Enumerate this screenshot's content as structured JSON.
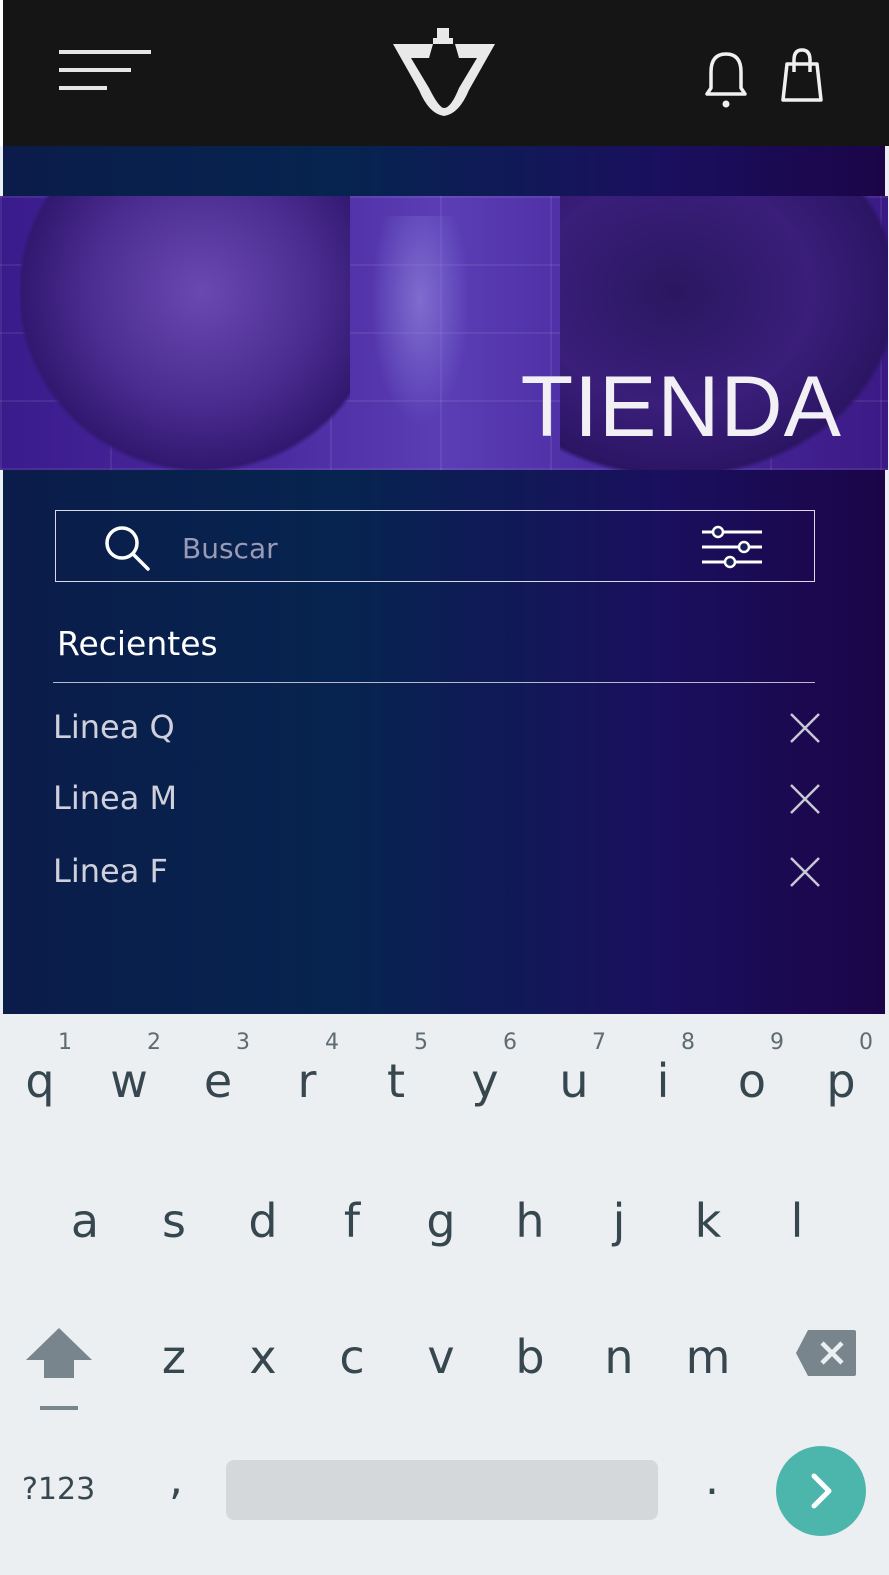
{
  "header": {
    "menu_icon": "hamburger-menu-icon",
    "logo": "rs-logo",
    "notification_icon": "bell-icon",
    "cart_icon": "shopping-bag-icon"
  },
  "banner": {
    "title": "TIENDA"
  },
  "search": {
    "placeholder": "Buscar",
    "value": "",
    "filter_icon": "sliders-filter-icon"
  },
  "recent": {
    "title": "Recientes",
    "items": [
      {
        "label": "Linea Q"
      },
      {
        "label": "Linea M"
      },
      {
        "label": "Linea F"
      }
    ]
  },
  "keyboard": {
    "row1": [
      {
        "key": "q",
        "hint": "1"
      },
      {
        "key": "w",
        "hint": "2"
      },
      {
        "key": "e",
        "hint": "3"
      },
      {
        "key": "r",
        "hint": "4"
      },
      {
        "key": "t",
        "hint": "5"
      },
      {
        "key": "y",
        "hint": "6"
      },
      {
        "key": "u",
        "hint": "7"
      },
      {
        "key": "i",
        "hint": "8"
      },
      {
        "key": "o",
        "hint": "9"
      },
      {
        "key": "p",
        "hint": "0"
      }
    ],
    "row2": [
      "a",
      "s",
      "d",
      "f",
      "g",
      "h",
      "j",
      "k",
      "l"
    ],
    "row3": [
      "z",
      "x",
      "c",
      "v",
      "b",
      "n",
      "m"
    ],
    "symbols_label": "?123",
    "comma": ",",
    "period": ".",
    "accent_color": "#4db6ac"
  },
  "colors": {
    "header_bg": "#151515",
    "banner_tint": "#4b2a9f",
    "keyboard_bg": "#eceff1"
  }
}
